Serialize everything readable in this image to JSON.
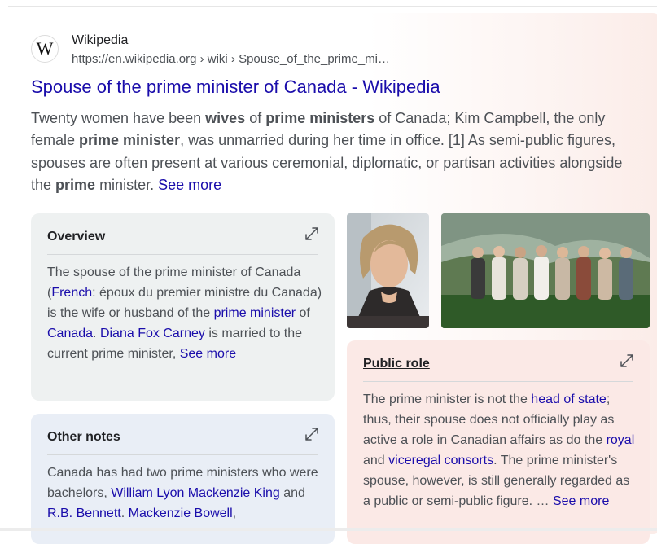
{
  "source": {
    "name": "Wikipedia",
    "url": "https://en.wikipedia.org › wiki › Spouse_of_the_prime_mi…",
    "logo_letter": "W"
  },
  "result": {
    "title": "Spouse of the prime minister of Canada - Wikipedia",
    "snippet": {
      "t1": "Twenty women have been ",
      "b1": "wives",
      "t2": " of ",
      "b2": "prime ministers",
      "t3": " of Canada; Kim Campbell, the only female ",
      "b3": "prime minister",
      "t4": ", was unmarried during her time in office. [1] As semi-public figures, spouses are often present at various ceremonial, diplomatic, or partisan activities alongside the ",
      "b4": "prime",
      "t5": " minister. ",
      "see_more": "See more"
    }
  },
  "overview": {
    "heading": "Overview",
    "t1": "The spouse of the prime minister of Canada (",
    "l1": "French",
    "t2": ": époux du premier ministre du Canada) is the wife or husband of the ",
    "l2": "prime minister",
    "t3": " of ",
    "l3": "Canada",
    "t4": ". ",
    "l4": "Diana Fox Carney",
    "t5": " is married to the current prime minister, ",
    "see_more": "See more"
  },
  "public_role": {
    "heading": "Public role",
    "t1": "The prime minister is not the ",
    "l1": "head of state",
    "t2": "; thus, their spouse does not officially play as active a role in Canadian affairs as do the ",
    "l2": "royal",
    "t3": " and ",
    "l3": "viceregal consorts",
    "t4": ". The prime minister's spouse, however, is still generally regarded as a public or semi-public figure. … ",
    "see_more": "See more"
  },
  "other_notes": {
    "heading": "Other notes",
    "t1": "Canada has had two prime ministers who were bachelors, ",
    "l1": "William Lyon Mackenzie King",
    "t2": " and ",
    "l2": "R.B. Bennett",
    "t3": ". ",
    "l3": "Mackenzie Bowell",
    "t4": ","
  },
  "colors": {
    "link": "#1a0dab",
    "text": "#4d5156",
    "overview_bg": "#eef1f1",
    "notes_bg": "#e9eef6",
    "public_bg": "#fbe9e6"
  }
}
